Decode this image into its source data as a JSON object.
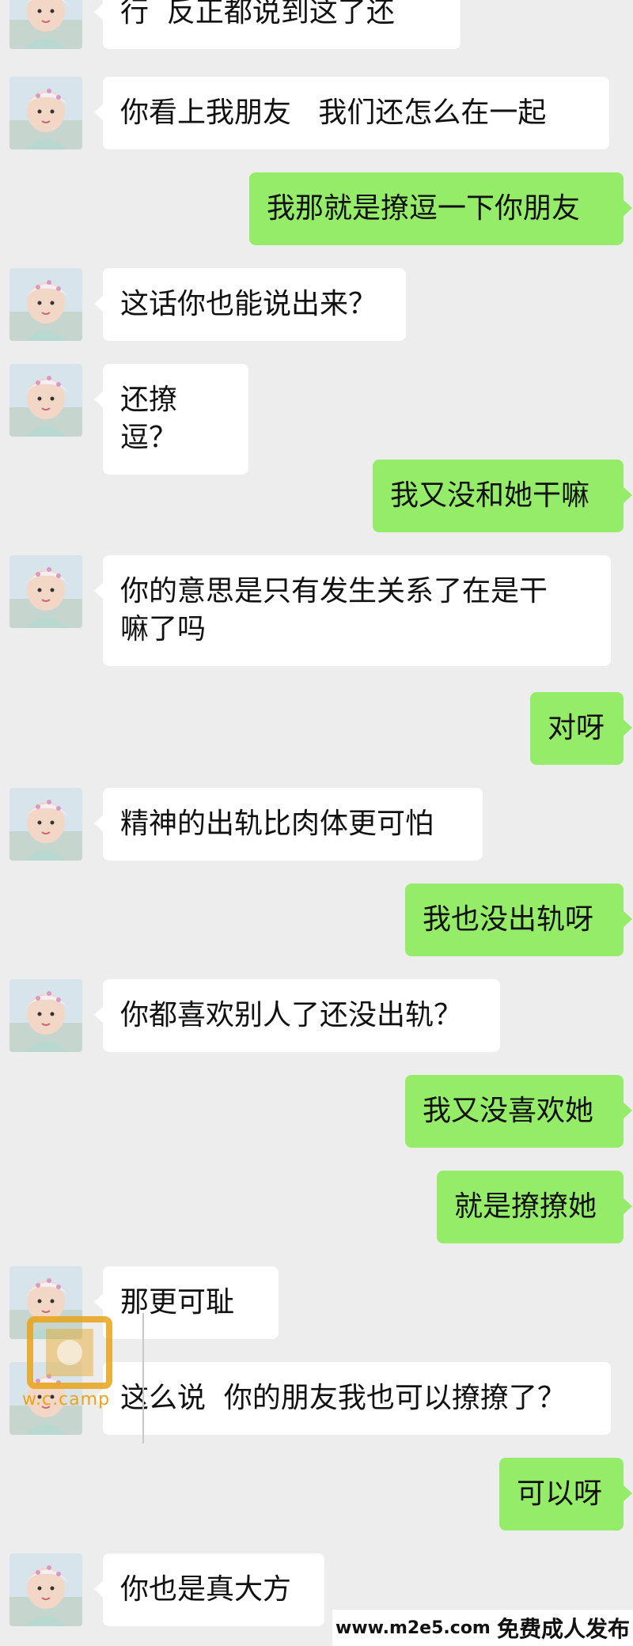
{
  "messages": [
    {
      "from": "other",
      "text": "行  反正都说到这了还"
    },
    {
      "from": "other",
      "text": "你看上我朋友   我们还怎么在一起"
    },
    {
      "from": "me",
      "text": "我那就是撩逗一下你朋友"
    },
    {
      "from": "other",
      "text": "这话你也能说出来？"
    },
    {
      "from": "other",
      "text": "还撩逗？"
    },
    {
      "from": "me",
      "text": "我又没和她干嘛"
    },
    {
      "from": "other",
      "text": "你的意思是只有发生关系了在是干\n嘛了吗"
    },
    {
      "from": "me",
      "text": "对呀"
    },
    {
      "from": "other",
      "text": "精神的出轨比肉体更可怕"
    },
    {
      "from": "me",
      "text": "我也没出轨呀"
    },
    {
      "from": "other",
      "text": "你都喜欢别人了还没出轨？"
    },
    {
      "from": "me",
      "text": "我又没喜欢她"
    },
    {
      "from": "me",
      "text": "就是撩撩她"
    },
    {
      "from": "other",
      "text": "那更可耻"
    },
    {
      "from": "other",
      "text": "这么说  你的朋友我也可以撩撩了？"
    },
    {
      "from": "me",
      "text": "可以呀"
    },
    {
      "from": "other",
      "text": "你也是真大方"
    }
  ],
  "watermark": {
    "logo_text": "w.c.camp",
    "url": "www.m2e5.com",
    "caption": "免费成人发布"
  },
  "colors": {
    "background": "#ededed",
    "incoming_bubble": "#ffffff",
    "outgoing_bubble": "#95ec69",
    "logo": "#e9a41a"
  }
}
